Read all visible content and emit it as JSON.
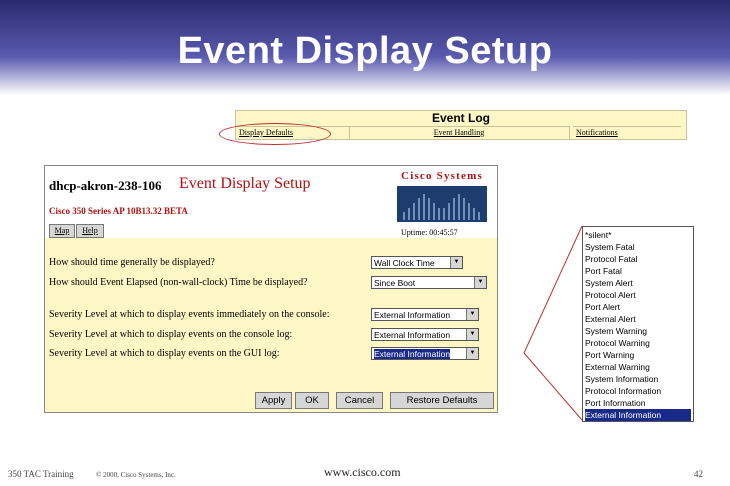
{
  "slide": {
    "title": "Event Display Setup"
  },
  "event_log": {
    "heading": "Event Log",
    "tabs": [
      "Display Defaults",
      "Event Handling",
      "Notifications"
    ]
  },
  "frame": {
    "host": "dhcp-akron-238-106",
    "title": "Event Display Setup",
    "model": "Cisco 350 Series AP 10B13.32 BETA",
    "logo": "Cisco Systems",
    "uptime": "Uptime: 00:45:57",
    "nav": {
      "map": "Map",
      "help": "Help"
    },
    "settings": [
      {
        "question": "How should time generally be displayed?",
        "value": "Wall Clock Time"
      },
      {
        "question": "How should Event Elapsed (non-wall-clock) Time be displayed?",
        "value": "Since Boot"
      },
      {
        "question": "Severity Level at which to display events immediately on the console:",
        "value": "External Information"
      },
      {
        "question": "Severity Level at which to display events on the console log:",
        "value": "External Information"
      },
      {
        "question": "Severity Level at which to display events on the GUI log:",
        "value": "External Information"
      }
    ],
    "buttons": {
      "apply": "Apply",
      "ok": "OK",
      "cancel": "Cancel",
      "restore": "Restore Defaults"
    }
  },
  "dropdown": {
    "options": [
      "*silent*",
      "System Fatal",
      "Protocol Fatal",
      "Port Fatal",
      "System Alert",
      "Protocol Alert",
      "Port Alert",
      "External Alert",
      "System Warning",
      "Protocol Warning",
      "Port Warning",
      "External Warning",
      "System Information",
      "Protocol Information",
      "Port Information",
      "External Information"
    ],
    "selected": "External Information"
  },
  "footer": {
    "left": "350 TAC Training",
    "copyright": "© 2000, Cisco Systems, Inc.",
    "url": "www.cisco.com",
    "page": "42"
  }
}
